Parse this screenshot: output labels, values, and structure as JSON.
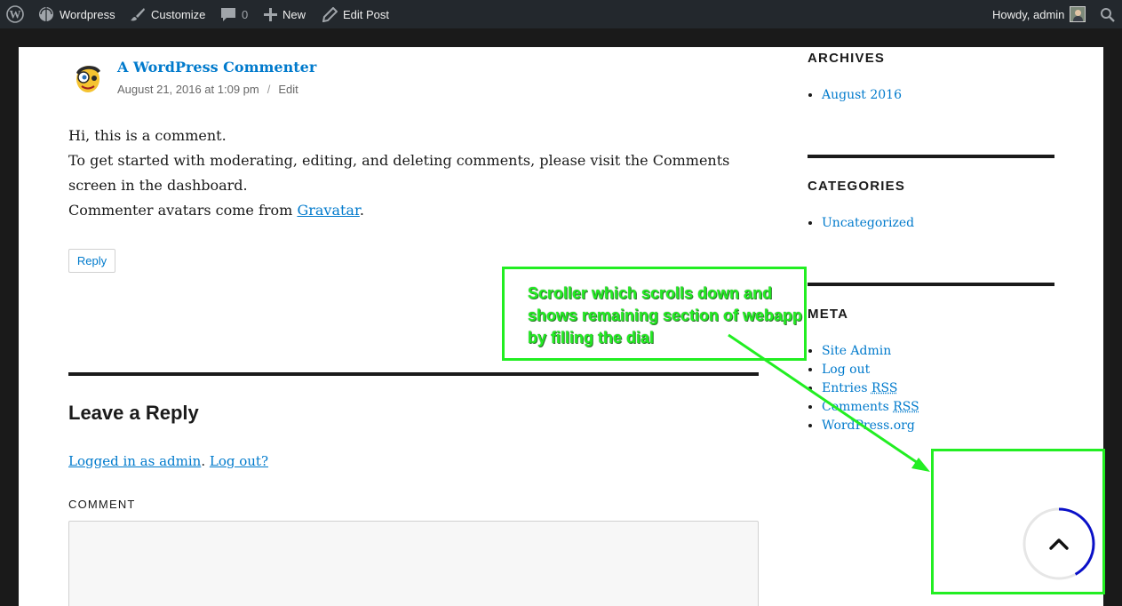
{
  "adminbar": {
    "wp_icon": "wordpress-logo-icon",
    "site_name": "Wordpress",
    "customize": "Customize",
    "comments_count": "0",
    "new": "New",
    "edit_post": "Edit Post",
    "greeting": "Howdy, admin",
    "search_icon": "search-icon"
  },
  "comment": {
    "author": "A WordPress Commenter",
    "date": "August 21, 2016 at 1:09 pm",
    "separator": "/",
    "edit": "Edit",
    "line1": "Hi, this is a comment.",
    "line2": "To get started with moderating, editing, and deleting comments, please visit the Comments screen in the dashboard.",
    "line3_pre": "Commenter avatars come from ",
    "line3_link": "Gravatar",
    "line3_post": ".",
    "reply": "Reply"
  },
  "reply_form": {
    "title": "Leave a Reply",
    "logged_in": "Logged in as admin",
    "dot": ". ",
    "logout": "Log out?",
    "comment_label": "COMMENT"
  },
  "sidebar": {
    "archives_title": "ARCHIVES",
    "archives": [
      "August 2016"
    ],
    "categories_title": "CATEGORIES",
    "categories": [
      "Uncategorized"
    ],
    "meta_title": "META",
    "meta": {
      "site_admin": "Site Admin",
      "log_out": "Log out",
      "entries_pre": "Entries ",
      "entries_rss": "RSS",
      "comments_pre": "Comments ",
      "comments_rss": "RSS",
      "wordpress_org": "WordPress.org"
    }
  },
  "annotation": {
    "text": "Scroller which scrolls down and shows remaining section of webapp by filling the dial",
    "color": "#22ee22"
  },
  "scroller": {
    "icon": "chevron-up-icon",
    "progress": 0.42,
    "track_color": "#e6e6e6",
    "fill_color": "#0a10c8"
  },
  "colors": {
    "link": "#007acc",
    "adminbar": "#23282d"
  }
}
